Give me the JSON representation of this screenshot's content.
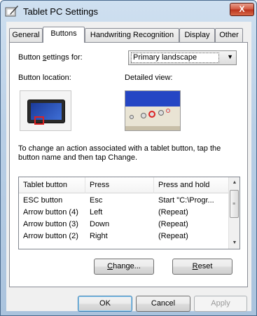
{
  "window": {
    "title": "Tablet PC Settings",
    "close_glyph": "X",
    "icon": "tablet-pen-icon"
  },
  "tabs": [
    {
      "label": "General",
      "active": false
    },
    {
      "label": "Buttons",
      "active": true
    },
    {
      "label": "Handwriting Recognition",
      "active": false
    },
    {
      "label": "Display",
      "active": false
    },
    {
      "label": "Other",
      "active": false
    }
  ],
  "buttons_tab": {
    "settings_for_label_pre": "Button ",
    "settings_for_label_u": "s",
    "settings_for_label_post": "ettings for:",
    "settings_for_value": "Primary landscape",
    "location_label": "Button location:",
    "detail_label": "Detailed view:",
    "instructions": "To change an action associated with a tablet button, tap the button name and then tap Change.",
    "list": {
      "columns": [
        "Tablet button",
        "Press",
        "Press and hold"
      ],
      "rows": [
        [
          "ESC button",
          "Esc",
          "Start \"C:\\Progr..."
        ],
        [
          "Arrow button (4)",
          "Left",
          "(Repeat)"
        ],
        [
          "Arrow button (3)",
          "Down",
          "(Repeat)"
        ],
        [
          "Arrow button (2)",
          "Right",
          "(Repeat)"
        ]
      ]
    },
    "change_button_u": "C",
    "change_button_rest": "hange...",
    "reset_button_u": "R",
    "reset_button_rest": "eset"
  },
  "footer": {
    "ok": "OK",
    "cancel": "Cancel",
    "apply": "Apply"
  },
  "colors": {
    "accent_blue": "#2546c4",
    "marker_red": "#dd2222",
    "close_red": "#c8442c"
  }
}
